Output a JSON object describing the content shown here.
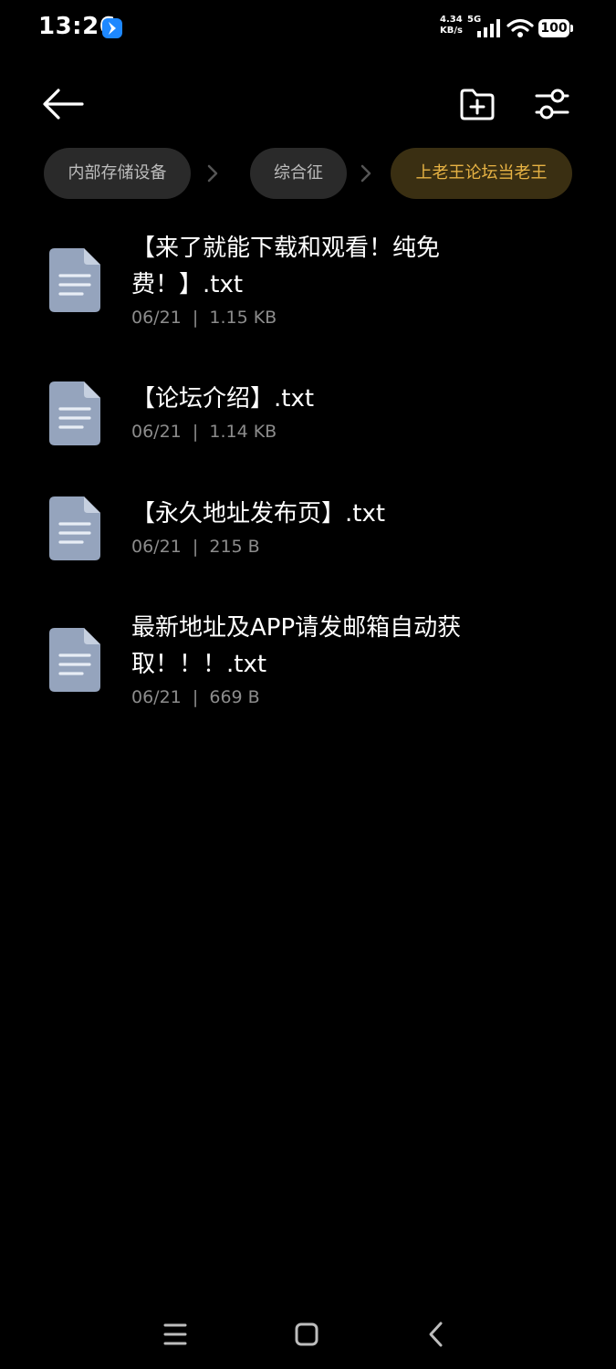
{
  "status_bar": {
    "time": "13:26",
    "net_speed_value": "4.34",
    "net_speed_unit": "KB/s",
    "network_type": "5G",
    "battery": "100"
  },
  "toolbar": {
    "back_icon": "arrow-left-icon",
    "new_folder_icon": "folder-plus-icon",
    "filter_icon": "sliders-icon"
  },
  "breadcrumb": {
    "items": [
      {
        "label": "内部存储设备"
      },
      {
        "label": "综合征"
      },
      {
        "label": "上老王论坛当老王"
      }
    ],
    "active_color": "#e7b344"
  },
  "files": [
    {
      "name": "【来了就能下载和观看！纯免费！】.txt",
      "date": "06/21",
      "size": "1.15 KB"
    },
    {
      "name": "【论坛介绍】.txt",
      "date": "06/21",
      "size": "1.14 KB"
    },
    {
      "name": "【永久地址发布页】.txt",
      "date": "06/21",
      "size": "215 B"
    },
    {
      "name": "最新地址及APP请发邮箱自动获取！！！.txt",
      "date": "06/21",
      "size": "669 B"
    }
  ],
  "meta_separator": "|",
  "nav_bar": {
    "menu_icon": "menu-icon",
    "home_icon": "square-icon",
    "back_icon": "chevron-left-icon"
  }
}
